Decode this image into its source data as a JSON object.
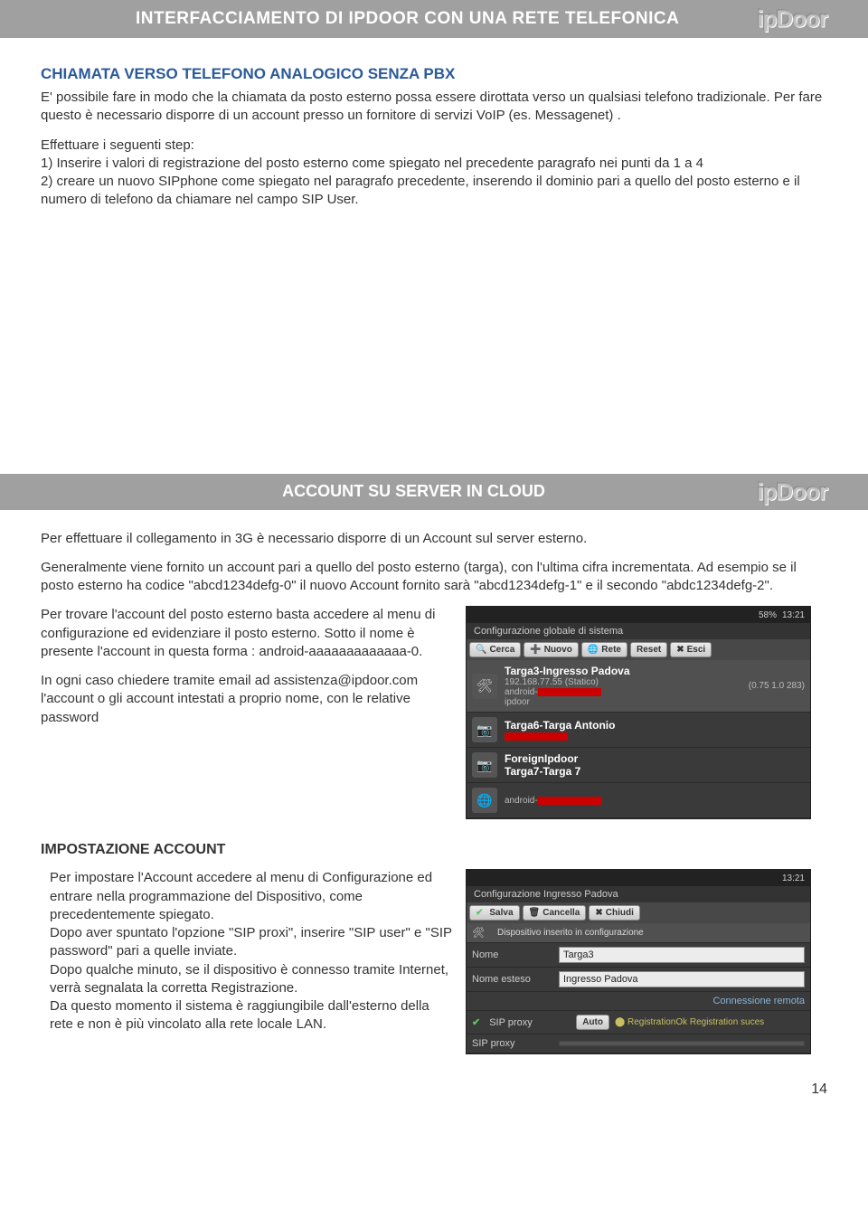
{
  "banner1": "INTERFACCIAMENTO DI IPDOOR CON UNA RETE TELEFONICA",
  "section1": {
    "heading": "CHIAMATA VERSO TELEFONO ANALOGICO SENZA PBX",
    "p1": "E' possibile fare in modo che la chiamata da posto esterno possa essere dirottata verso un qualsiasi telefono tradizionale. Per fare questo è necessario disporre di un account presso un fornitore di servizi VoIP (es. Messagenet) .",
    "p2": "Effettuare i seguenti step:",
    "l1": "1) Inserire i valori di registrazione del posto esterno come spiegato nel precedente paragrafo nei punti da 1 a 4",
    "l2": "2) creare un nuovo SIPphone come spiegato nel paragrafo precedente, inserendo il dominio pari a quello del posto esterno e il numero di telefono da chiamare nel campo SIP User."
  },
  "banner2": "ACCOUNT SU SERVER IN CLOUD",
  "section2": {
    "p1": "Per effettuare il collegamento in 3G è necessario disporre di un Account sul server esterno.",
    "p2": "Generalmente viene fornito un account pari a quello del posto esterno (targa), con l'ultima cifra incrementata. Ad esempio se il posto esterno ha codice \"abcd1234defg-0\" il nuovo Account fornito sarà \"abcd1234defg-1\" e il secondo \"abdc1234defg-2\".",
    "p3": "Per trovare l'account del posto esterno basta accedere al menu di configurazione ed evidenziare il posto esterno. Sotto il nome è presente l'account in questa forma : android-aaaaaaaaaaaaa-0.",
    "p4": "In ogni caso chiedere tramite email ad assistenza@ipdoor.com l'account o gli account intestati a proprio nome, con le relative password"
  },
  "section3": {
    "heading": "IMPOSTAZIONE ACCOUNT",
    "p1": "Per impostare l'Account accedere al menu di Configurazione ed entrare nella programmazione del Dispositivo, come precedentemente  spiegato.",
    "p2": "Dopo aver spuntato l'opzione \"SIP proxi\", inserire \"SIP user\" e \"SIP password\" pari a quelle inviate.",
    "p3": "Dopo qualche minuto, se il dispositivo è connesso tramite Internet, verrà segnalata la corretta Registrazione.",
    "p4": "Da questo momento il sistema è raggiungibile dall'esterno della rete e non è più vincolato alla rete locale LAN."
  },
  "shot1": {
    "status_time": "13:21",
    "status_batt": "58%",
    "panel_title": "Configurazione globale di sistema",
    "btn_cerca": "Cerca",
    "btn_nuovo": "Nuovo",
    "btn_rete": "Rete",
    "btn_reset": "Reset",
    "btn_esci": "Esci",
    "dev1_title": "Targa3-Ingresso Padova",
    "dev1_ip": "192.168.77.55 (Statico)",
    "dev1_acct": "android-",
    "dev1_ver": "(0.75 1.0 283)",
    "dev1_host": "ipdoor",
    "dev2_title": "Targa6-Targa Antonio",
    "dev3_title": "ForeignIpdoor",
    "dev4_title": "Targa7-Targa 7",
    "dev4_acct": "android-"
  },
  "shot2": {
    "status_time": "13:21",
    "panel_title": "Configurazione Ingresso Padova",
    "btn_salva": "Salva",
    "btn_cancella": "Cancella",
    "btn_chiudi": "Chiudi",
    "note": "Dispositivo inserito in configurazione",
    "lbl_nome": "Nome",
    "val_nome": "Targa3",
    "lbl_nome_esteso": "Nome esteso",
    "val_nome_esteso": "Ingresso Padova",
    "conn_remota": "Connessione remota",
    "sip_proxy": "SIP proxy",
    "auto": "Auto",
    "reg_ok": "RegistrationOk Registration suces",
    "sip_proxy2": "SIP proxy"
  },
  "page_number": "14"
}
